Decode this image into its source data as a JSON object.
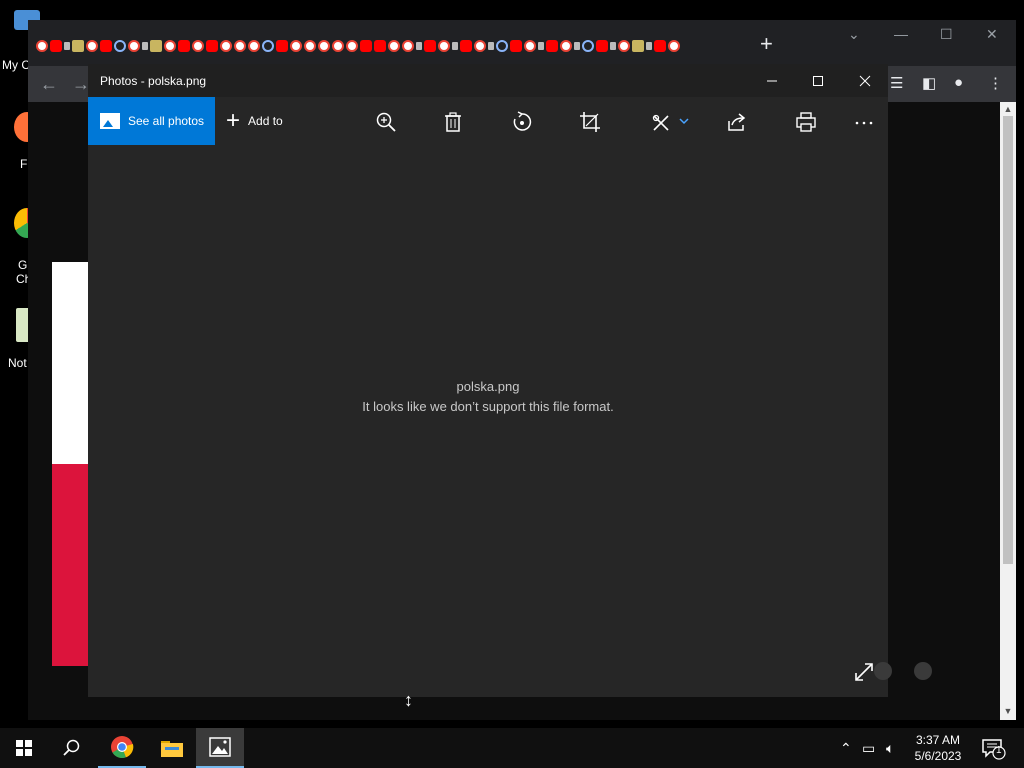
{
  "desktop": {
    "icons": [
      {
        "name": "My Computer",
        "label": "My C"
      },
      {
        "name": "Firefox",
        "label": "F"
      },
      {
        "name": "Google Chrome",
        "label": "G",
        "label2": "Ch"
      },
      {
        "name": "Notepad",
        "label": "Not"
      }
    ]
  },
  "browser": {
    "new_tab_symbol": "+"
  },
  "photos": {
    "title": "Photos - polska.png",
    "toolbar": {
      "see_all_label": "See all photos",
      "add_to_label": "Add to"
    },
    "file_name": "polska.png",
    "error_message": "It looks like we don’t support this file format."
  },
  "taskbar": {
    "time": "3:37 AM",
    "date": "5/6/2023",
    "notification_count": "1"
  },
  "colors": {
    "accent": "#0078d7",
    "flag_red": "#dc143c",
    "flag_white": "#ffffff"
  }
}
